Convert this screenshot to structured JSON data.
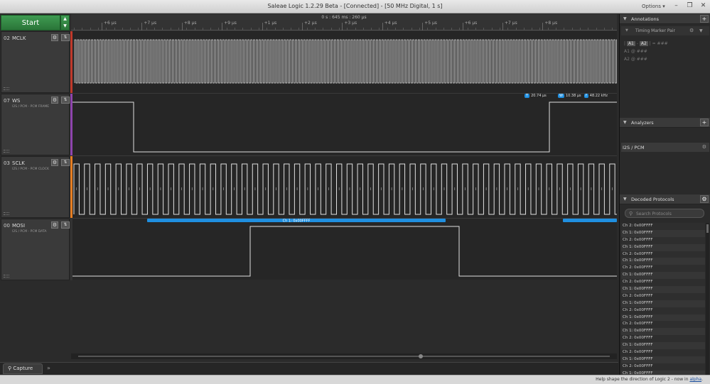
{
  "window": {
    "title": "Saleae Logic 1.2.29 Beta - [Connected] - [50 MHz Digital, 1 s]",
    "options_label": "Options ▾"
  },
  "toolbar": {
    "start_label": "Start"
  },
  "timeline": {
    "readout": "0 s : 645 ms : 260 µs",
    "ticks": [
      "+6 µs",
      "+7 µs",
      "+8 µs",
      "+9 µs",
      "+1 µs",
      "+2 µs",
      "+3 µs",
      "+4 µs",
      "+5 µs",
      "+6 µs",
      "+7 µs",
      "+8 µs"
    ]
  },
  "channels": [
    {
      "num": "02",
      "name": "MCLK",
      "sub": "",
      "color": "#c0392b"
    },
    {
      "num": "07",
      "name": "WS",
      "sub": "I2S / PCM - PCM FRAME",
      "color": "#8e44ad"
    },
    {
      "num": "03",
      "name": "SCLK",
      "sub": "I2S / PCM - PCM CLOCK",
      "color": "#e67e22"
    },
    {
      "num": "00",
      "name": "MOSI",
      "sub": "I2S / PCM - PCM DATA",
      "color": "#333333"
    }
  ],
  "measurements": {
    "width_label": "20.74 µs",
    "period_label": "10.38 µs",
    "freq_label": "48.22 kHz"
  },
  "decode_bubble": {
    "label": "Ch 1: 0x00FFFF"
  },
  "tabs": {
    "capture_label": "Capture",
    "more_label": "»"
  },
  "status": {
    "text": "Help shape the direction of Logic 2 - now in",
    "link": "alpha",
    "suffix": "."
  },
  "annotations": {
    "title": "Annotations",
    "marker_pair": "Timing Marker Pair",
    "line1": {
      "pre": "| ",
      "a1": "A1",
      "mid": " - ",
      "a2": "A2",
      "post": " | = ###"
    },
    "line2": "A1  @  ###",
    "line3": "A2  @  ###"
  },
  "analyzers": {
    "title": "Analyzers",
    "items": [
      "I2S / PCM"
    ]
  },
  "decoded": {
    "title": "Decoded Protocols",
    "search_placeholder": "Search Protocols",
    "rows": [
      "Ch 2: 0x00FFFF",
      "Ch 1: 0x00FFFF",
      "Ch 2: 0x00FFFF",
      "Ch 1: 0x00FFFF",
      "Ch 2: 0x00FFFF",
      "Ch 1: 0x00FFFF",
      "Ch 2: 0x00FFFF",
      "Ch 1: 0x00FFFF",
      "Ch 2: 0x00FFFF",
      "Ch 1: 0x00FFFF",
      "Ch 2: 0x00FFFF",
      "Ch 1: 0x00FFFF",
      "Ch 2: 0x00FFFF",
      "Ch 1: 0x00FFFF",
      "Ch 2: 0x00FFFF",
      "Ch 1: 0x00FFFF",
      "Ch 2: 0x00FFFF",
      "Ch 1: 0x00FFFF",
      "Ch 2: 0x00FFFF",
      "Ch 1: 0x00FFFF",
      "Ch 2: 0x00FFFF",
      "Ch 1: 0x00FFFF"
    ]
  }
}
